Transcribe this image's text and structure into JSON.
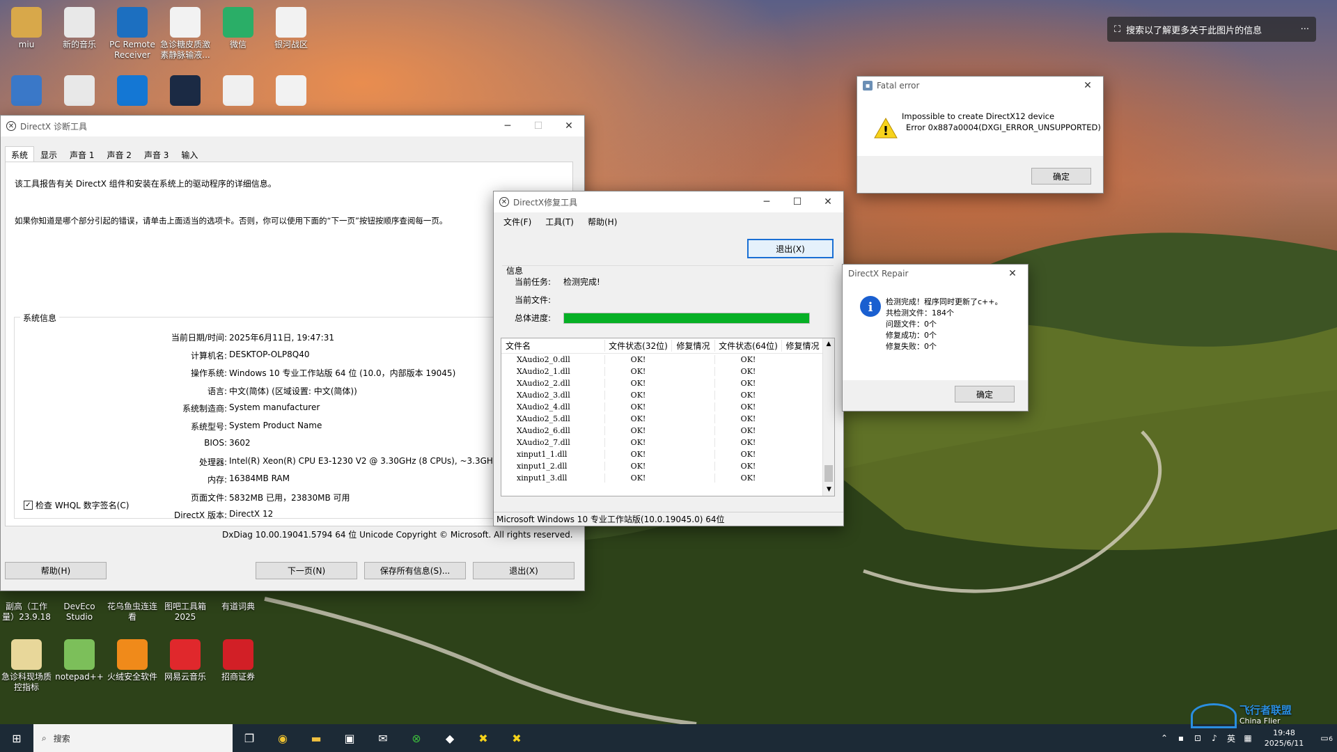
{
  "desktop": {
    "top_icons": [
      {
        "label": "miu",
        "color": "#d8a84a"
      },
      {
        "label": "新的音乐",
        "color": "#e8e8e8"
      },
      {
        "label": "PC Remote Receiver",
        "color": "#1c6fc0"
      },
      {
        "label": "急诊糖皮质激素静脉输液...",
        "color": "#f2f2f2"
      },
      {
        "label": "微信",
        "color": "#2aae67"
      },
      {
        "label": "银河战区",
        "color": "#f2f2f2"
      }
    ],
    "second_icons": [
      {
        "label": "",
        "color": "#3a78c8"
      },
      {
        "label": "",
        "color": "#e8e8e8"
      },
      {
        "label": "",
        "color": "#1477d4"
      },
      {
        "label": "",
        "color": "#1b2a44"
      },
      {
        "label": "",
        "color": "#f0f0f0"
      },
      {
        "label": "",
        "color": "#f2f2f2"
      }
    ],
    "bottom_row1": [
      {
        "label": "副高（工作量）23.9.18"
      },
      {
        "label": "DevEco Studio"
      },
      {
        "label": "花乌鱼虫连连看"
      },
      {
        "label": "图吧工具箱2025"
      },
      {
        "label": "有道词典"
      }
    ],
    "bottom_row2": [
      {
        "label": "急诊科现场质控指标",
        "color": "#e8d79a"
      },
      {
        "label": "notepad++",
        "color": "#7cbf5a"
      },
      {
        "label": "火绒安全软件",
        "color": "#f08a1a"
      },
      {
        "label": "网易云音乐",
        "color": "#e0282c"
      },
      {
        "label": "招商证券",
        "color": "#d21f26"
      }
    ]
  },
  "search_banner": {
    "text": "搜索以了解更多关于此图片的信息",
    "more": "···"
  },
  "dxdiag": {
    "title": "DirectX 诊断工具",
    "tabs": [
      "系统",
      "显示",
      "声音 1",
      "声音 2",
      "声音 3",
      "输入"
    ],
    "intro1": "该工具报告有关 DirectX 组件和安装在系统上的驱动程序的详细信息。",
    "intro2": "如果你知道是哪个部分引起的错误，请单击上面适当的选项卡。否则，你可以使用下面的“下一页”按钮按顺序查阅每一页。",
    "group_label": "系统信息",
    "rows": [
      {
        "label": "当前日期/时间:",
        "value": "2025年6月11日, 19:47:31"
      },
      {
        "label": "计算机名:",
        "value": "DESKTOP-OLP8Q40"
      },
      {
        "label": "操作系统:",
        "value": "Windows 10 专业工作站版 64 位 (10.0，内部版本 19045)"
      },
      {
        "label": "语言:",
        "value": "中文(简体) (区域设置: 中文(简体))"
      },
      {
        "label": "系统制造商:",
        "value": "System manufacturer"
      },
      {
        "label": "系统型号:",
        "value": "System Product Name"
      },
      {
        "label": "BIOS:",
        "value": "3602"
      },
      {
        "label": "处理器:",
        "value": "Intel(R) Xeon(R) CPU E3-1230 V2 @ 3.30GHz (8 CPUs), ~3.3GHz"
      },
      {
        "label": "内存:",
        "value": "16384MB RAM"
      },
      {
        "label": "页面文件:",
        "value": "5832MB 已用，23830MB 可用"
      },
      {
        "label": "DirectX 版本:",
        "value": "DirectX 12"
      }
    ],
    "whql_label": "检查 WHQL 数字签名(C)",
    "footer": "DxDiag 10.00.19041.5794 64 位 Unicode  Copyright © Microsoft. All rights reserved.",
    "buttons": {
      "help": "帮助(H)",
      "next": "下一页(N)",
      "save": "保存所有信息(S)...",
      "exit": "退出(X)"
    }
  },
  "repair": {
    "title": "DirectX修复工具",
    "menu": [
      "文件(F)",
      "工具(T)",
      "帮助(H)"
    ],
    "exit_button": "退出(X)",
    "info_label": "信息",
    "current_task_label": "当前任务:",
    "current_task_value": "检测完成!",
    "current_file_label": "当前文件:",
    "progress_label": "总体进度:",
    "progress": 1.0,
    "progress_color": "#06b025",
    "columns": [
      "文件名",
      "文件状态(32位)",
      "修复情况",
      "文件状态(64位)",
      "修复情况"
    ],
    "rows": [
      {
        "name": "XAudio2_0.dll",
        "s32": "OK!",
        "s64": "OK!"
      },
      {
        "name": "XAudio2_1.dll",
        "s32": "OK!",
        "s64": "OK!"
      },
      {
        "name": "XAudio2_2.dll",
        "s32": "OK!",
        "s64": "OK!"
      },
      {
        "name": "XAudio2_3.dll",
        "s32": "OK!",
        "s64": "OK!"
      },
      {
        "name": "XAudio2_4.dll",
        "s32": "OK!",
        "s64": "OK!"
      },
      {
        "name": "XAudio2_5.dll",
        "s32": "OK!",
        "s64": "OK!"
      },
      {
        "name": "XAudio2_6.dll",
        "s32": "OK!",
        "s64": "OK!"
      },
      {
        "name": "XAudio2_7.dll",
        "s32": "OK!",
        "s64": "OK!"
      },
      {
        "name": "xinput1_1.dll",
        "s32": "OK!",
        "s64": "OK!"
      },
      {
        "name": "xinput1_2.dll",
        "s32": "OK!",
        "s64": "OK!"
      },
      {
        "name": "xinput1_3.dll",
        "s32": "OK!",
        "s64": "OK!"
      }
    ],
    "status": "Microsoft Windows 10 专业工作站版(10.0.19045.0) 64位"
  },
  "fatal": {
    "title": "Fatal error",
    "line1": "Impossible to create DirectX12 device",
    "line2": "Error 0x887a0004(DXGI_ERROR_UNSUPPORTED)",
    "ok": "确定"
  },
  "dxrepair_msg": {
    "title": "DirectX Repair",
    "lines": [
      "检测完成！程序同时更新了c++。",
      "共检测文件：184个",
      "问题文件：0个",
      "修复成功：0个",
      "修复失败：0个"
    ],
    "ok": "确定"
  },
  "taskbar": {
    "search_placeholder": "搜索",
    "tray_lang": "英",
    "clock_time": "19:48",
    "clock_date": "2025/6/11",
    "notif_count": "6"
  },
  "watermark": {
    "text": "飞行者联盟",
    "sub": "China Flier"
  }
}
